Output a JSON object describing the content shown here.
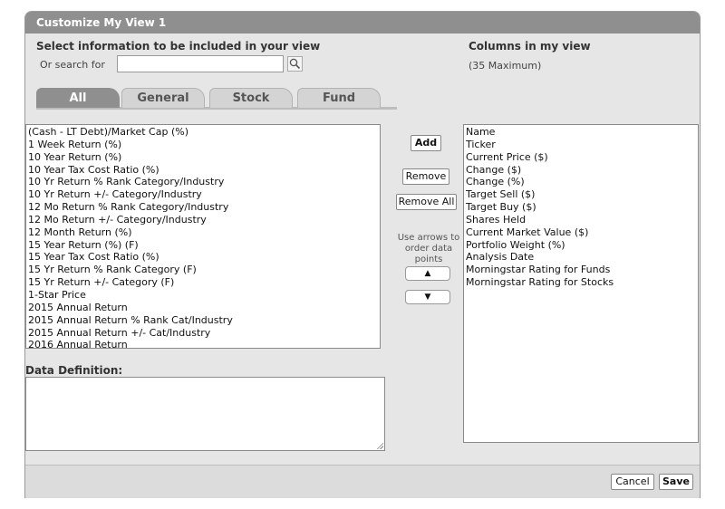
{
  "dialog": {
    "title": "Customize My View 1"
  },
  "left": {
    "heading": "Select information to be included in your view",
    "search_label": "Or search for",
    "search_value": "",
    "search_placeholder": "",
    "tabs": [
      {
        "label": "All",
        "active": true
      },
      {
        "label": "General",
        "active": false
      },
      {
        "label": "Stock",
        "active": false
      },
      {
        "label": "Fund",
        "active": false
      }
    ],
    "available": [
      "(Cash - LT Debt)/Market Cap (%)",
      "1 Week Return (%)",
      "10 Year Return (%)",
      "10 Year Tax Cost Ratio (%)",
      "10 Yr Return % Rank Category/Industry",
      "10 Yr Return +/- Category/Industry",
      "12 Mo Return % Rank Category/Industry",
      "12 Mo Return +/- Category/Industry",
      "12 Month Return (%)",
      "15 Year Return (%) (F)",
      "15 Year Tax Cost Ratio (%)",
      "15 Yr Return % Rank Category (F)",
      "15 Yr Return +/- Category (F)",
      "1-Star Price",
      "2015 Annual Return",
      "2015 Annual Return % Rank Cat/Industry",
      "2015 Annual Return +/- Cat/Industry",
      "2016 Annual Return"
    ],
    "definition_label": "Data Definition:",
    "definition_value": ""
  },
  "middle": {
    "add_label": "Add",
    "remove_label": "Remove",
    "remove_all_label": "Remove All",
    "arrows_note": "Use arrows to order data points",
    "up_glyph": "▲",
    "down_glyph": "▼"
  },
  "right": {
    "heading": "Columns in my view",
    "max_note": "(35 Maximum)",
    "columns": [
      "Name",
      "Ticker",
      "Current Price ($)",
      "Change ($)",
      "Change (%)",
      "Target Sell ($)",
      "Target Buy ($)",
      "Shares Held",
      "Current Market Value ($)",
      "Portfolio Weight (%)",
      "Analysis Date",
      "Morningstar Rating for Funds",
      "Morningstar Rating for Stocks"
    ]
  },
  "footer": {
    "cancel_label": "Cancel",
    "save_label": "Save"
  },
  "icons": {
    "search": "magnifier-icon"
  }
}
